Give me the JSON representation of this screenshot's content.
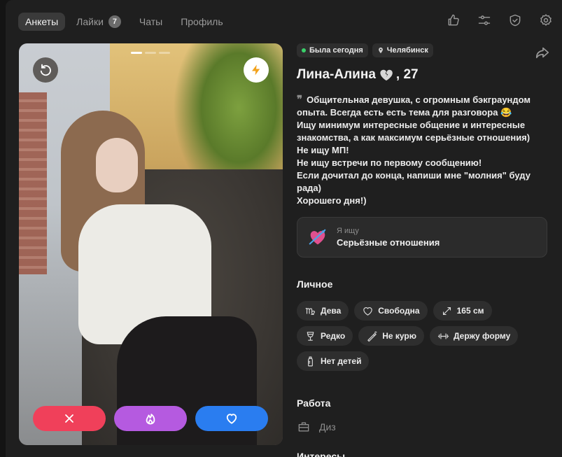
{
  "tabs": [
    {
      "label": "Анкеты",
      "active": true
    },
    {
      "label": "Лайки",
      "badge": "7"
    },
    {
      "label": "Чаты"
    },
    {
      "label": "Профиль"
    }
  ],
  "top_icons": [
    "thumbs-up-icon",
    "filters-icon",
    "shield-check-icon",
    "settings-gear-icon"
  ],
  "photo": {
    "pages_total": 3,
    "current_page": 1
  },
  "profile": {
    "status": "Была сегодня",
    "city": "Челябинск",
    "name": "Лина-Алина",
    "age": ", 27",
    "bio": "Общительная девушка, с огромным бэкграундом опыта. Всегда есть есть тема для разговора 😂\nИщу минимум интересные общение и интересные знакомства, а как максимум серьёзные отношения)\nНе ищу МП!\nНе ищу встречи по первому сообщению!\nЕсли дочитал до конца, напиши мне \"молния\" буду рада)\nХорошего дня!)",
    "seeking_label": "Я ищу",
    "seeking_value": "Серьёзные отношения"
  },
  "personal": {
    "title": "Личное",
    "tags": [
      {
        "label": "Дева",
        "icon": "virgo-icon"
      },
      {
        "label": "Свободна",
        "icon": "heart-outline-icon"
      },
      {
        "label": "165 см",
        "icon": "height-arrows-icon"
      },
      {
        "label": "Редко",
        "icon": "wine-glass-icon"
      },
      {
        "label": "Не курю",
        "icon": "cigarette-icon"
      },
      {
        "label": "Держу форму",
        "icon": "dumbbell-icon"
      },
      {
        "label": "Нет детей",
        "icon": "baby-bottle-icon"
      }
    ]
  },
  "work": {
    "title": "Работа",
    "value": "Диз"
  },
  "interests": {
    "title": "Интересы"
  },
  "colors": {
    "dislike": "#f0405a",
    "superlike": "#b55ae0",
    "like": "#2a7df0",
    "online": "#3ad06a"
  }
}
